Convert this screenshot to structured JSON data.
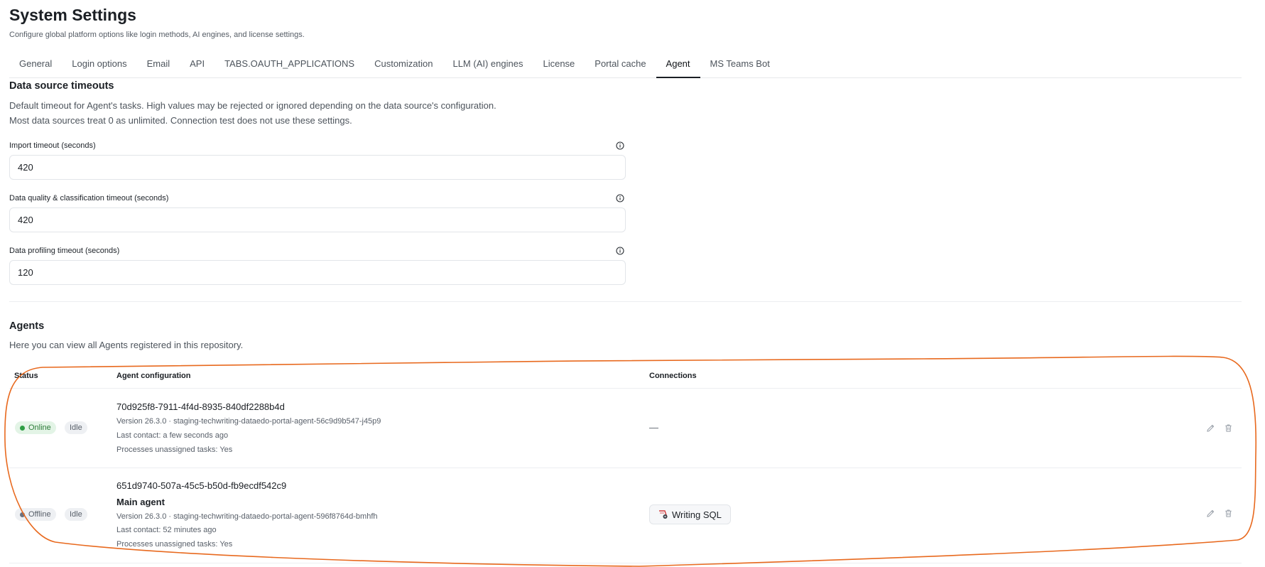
{
  "header": {
    "title": "System Settings",
    "subtitle": "Configure global platform options like login methods, AI engines, and license settings."
  },
  "tabs": [
    {
      "label": "General"
    },
    {
      "label": "Login options"
    },
    {
      "label": "Email"
    },
    {
      "label": "API"
    },
    {
      "label": "TABS.OAUTH_APPLICATIONS"
    },
    {
      "label": "Customization"
    },
    {
      "label": "LLM (AI) engines"
    },
    {
      "label": "License"
    },
    {
      "label": "Portal cache"
    },
    {
      "label": "Agent",
      "active": true
    },
    {
      "label": "MS Teams Bot"
    }
  ],
  "timeouts": {
    "title": "Data source timeouts",
    "desc_line1": "Default timeout for Agent's tasks. High values may be rejected or ignored depending on the data source's configuration.",
    "desc_line2": "Most data sources treat 0 as unlimited. Connection test does not use these settings.",
    "fields": [
      {
        "label": "Import timeout (seconds)",
        "value": "420"
      },
      {
        "label": "Data quality & classification timeout (seconds)",
        "value": "420"
      },
      {
        "label": "Data profiling timeout (seconds)",
        "value": "120"
      }
    ]
  },
  "agents": {
    "title": "Agents",
    "desc": "Here you can view all Agents registered in this repository.",
    "columns": {
      "status": "Status",
      "config": "Agent configuration",
      "connections": "Connections"
    },
    "rows": [
      {
        "status": "Online",
        "activity": "Idle",
        "id": "70d925f8-7911-4f4d-8935-840df2288b4d",
        "name": "",
        "version": "Version 26.3.0 · staging-techwriting-dataedo-portal-agent-56c9d9b547-j45p9",
        "last_contact": "Last contact: a few seconds ago",
        "processes": "Processes unassigned tasks: Yes",
        "connections_empty": "—"
      },
      {
        "status": "Offline",
        "activity": "Idle",
        "id": "651d9740-507a-45c5-b50d-fb9ecdf542c9",
        "name": "Main agent",
        "version": "Version 26.3.0 · staging-techwriting-dataedo-portal-agent-596f8764d-bmhfh",
        "last_contact": "Last contact: 52 minutes ago",
        "processes": "Processes unassigned tasks: Yes",
        "connection": "Writing SQL"
      }
    ]
  },
  "colors": {
    "online": "#2e9e44",
    "offline": "#6b7280",
    "annotation": "#e8691e",
    "active_tab": "#1b1f24"
  },
  "icons": [
    "info-icon",
    "edit-icon",
    "delete-icon",
    "connection-icon"
  ]
}
